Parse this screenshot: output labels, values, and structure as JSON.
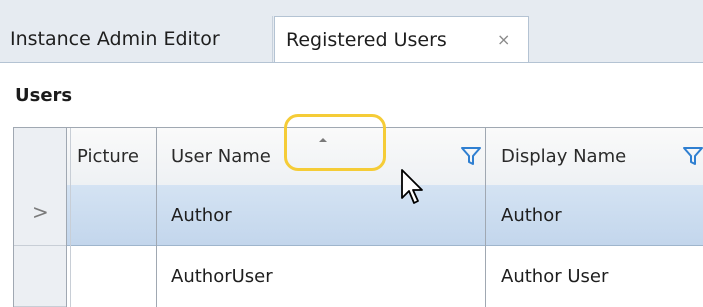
{
  "tabs": [
    {
      "label": "Instance Admin Editor"
    },
    {
      "label": "Registered Users",
      "close": "×"
    }
  ],
  "section_title": "Users",
  "grid": {
    "columns": [
      {
        "label": "Picture"
      },
      {
        "label": "User Name"
      },
      {
        "label": "Display Name"
      }
    ],
    "rows": [
      {
        "indicator": ">",
        "user_name": "Author",
        "display_name": "Author"
      },
      {
        "indicator": "",
        "user_name": "AuthorUser",
        "display_name": "Author User"
      }
    ]
  },
  "colors": {
    "highlight": "#f5cc37",
    "selected_row": "#c9dbef",
    "filter_icon": "#2f7fd1"
  }
}
